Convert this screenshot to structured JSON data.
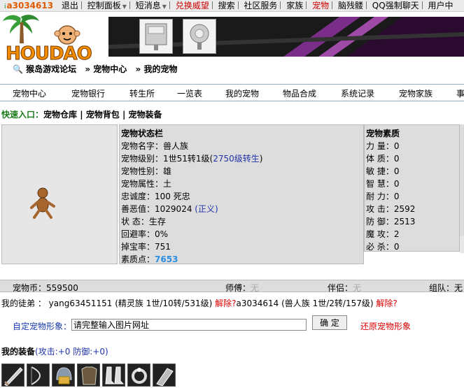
{
  "topbar": {
    "user_prefix": "i",
    "username": "a3034613",
    "logout": "退出",
    "control_panel": "控制面板",
    "short_msg": "短消息",
    "exchange": "兑换威望",
    "search": "搜索",
    "community": "社区服务",
    "clan": "家族",
    "pet": "宠物",
    "boneyard": "脑残髅",
    "qq_chat": "QQ强制聊天",
    "user_center": "用户中"
  },
  "logo_text": "HOUDAO",
  "breadcrumb": {
    "forum": "猴岛游戏论坛",
    "center": "宠物中心",
    "mine": "我的宠物"
  },
  "nav": [
    "宠物中心",
    "宠物银行",
    "转生所",
    "一览表",
    "我的宠物",
    "物品合成",
    "系统记录",
    "宠物家族",
    "事"
  ],
  "quick": {
    "label": "快速入口：",
    "items": [
      "宠物仓库",
      "宠物背包",
      "宠物装备"
    ]
  },
  "status": {
    "title": "宠物状态栏",
    "name_label": "宠物名字：",
    "name": "兽人族",
    "level_label": "宠物级别：",
    "level": "1世51转1级(",
    "level_link": "2750级转生",
    "level_close": ")",
    "gender_label": "宠物性别：",
    "gender": "雄",
    "attr_label": "宠物属性：",
    "attr": "土",
    "loyalty_label": "忠诚度：",
    "loyalty": "100 死忠",
    "karma_label": "善恶值：",
    "karma": "1029024",
    "karma_tag": "(正义)",
    "state_label": "状    态：",
    "state": "生存",
    "dodge_label": "回避率：",
    "dodge": "0%",
    "drop_label": "掉宝率：",
    "drop": "751",
    "points_label": "素质点：",
    "points": "7653"
  },
  "quality": {
    "title": "宠物素质",
    "rows": [
      {
        "label": "力    量：",
        "value": "0"
      },
      {
        "label": "体    质：",
        "value": "0"
      },
      {
        "label": "敏    捷：",
        "value": "0"
      },
      {
        "label": "智    慧：",
        "value": "0"
      },
      {
        "label": "耐    力：",
        "value": "0"
      },
      {
        "label": "攻    击：",
        "value": "2592"
      },
      {
        "label": "防    御：",
        "value": "2513"
      },
      {
        "label": "魔    攻：",
        "value": "2"
      },
      {
        "label": "必    杀：",
        "value": "0"
      }
    ]
  },
  "coins": {
    "coin_label": "宠物币：",
    "coin_value": "559500",
    "master_label": "师傅：",
    "master_value": "无",
    "partner_label": "伴侣：",
    "partner_value": "无",
    "group_label": "组队：",
    "group_value": "无"
  },
  "apprentice": {
    "label": "我的徒弟 ：",
    "a1": "yang63451151 (精灵族 1世/10转/531级)",
    "a1_release": "解除?",
    "a2": "a3034614 (兽人族 1世/2转/157级)",
    "a2_release": "解除?"
  },
  "custom": {
    "label": "自定宠物形象：",
    "input_value": "请完整输入图片网址",
    "confirm": "确 定",
    "restore": "还原宠物形象"
  },
  "equip": {
    "title": "我的装备",
    "stats": "(攻击:+0 防御:+0)"
  },
  "colors": {
    "accent_red": "#dd0000",
    "link_blue": "#2233aa",
    "panel_grey": "#dddddd"
  }
}
